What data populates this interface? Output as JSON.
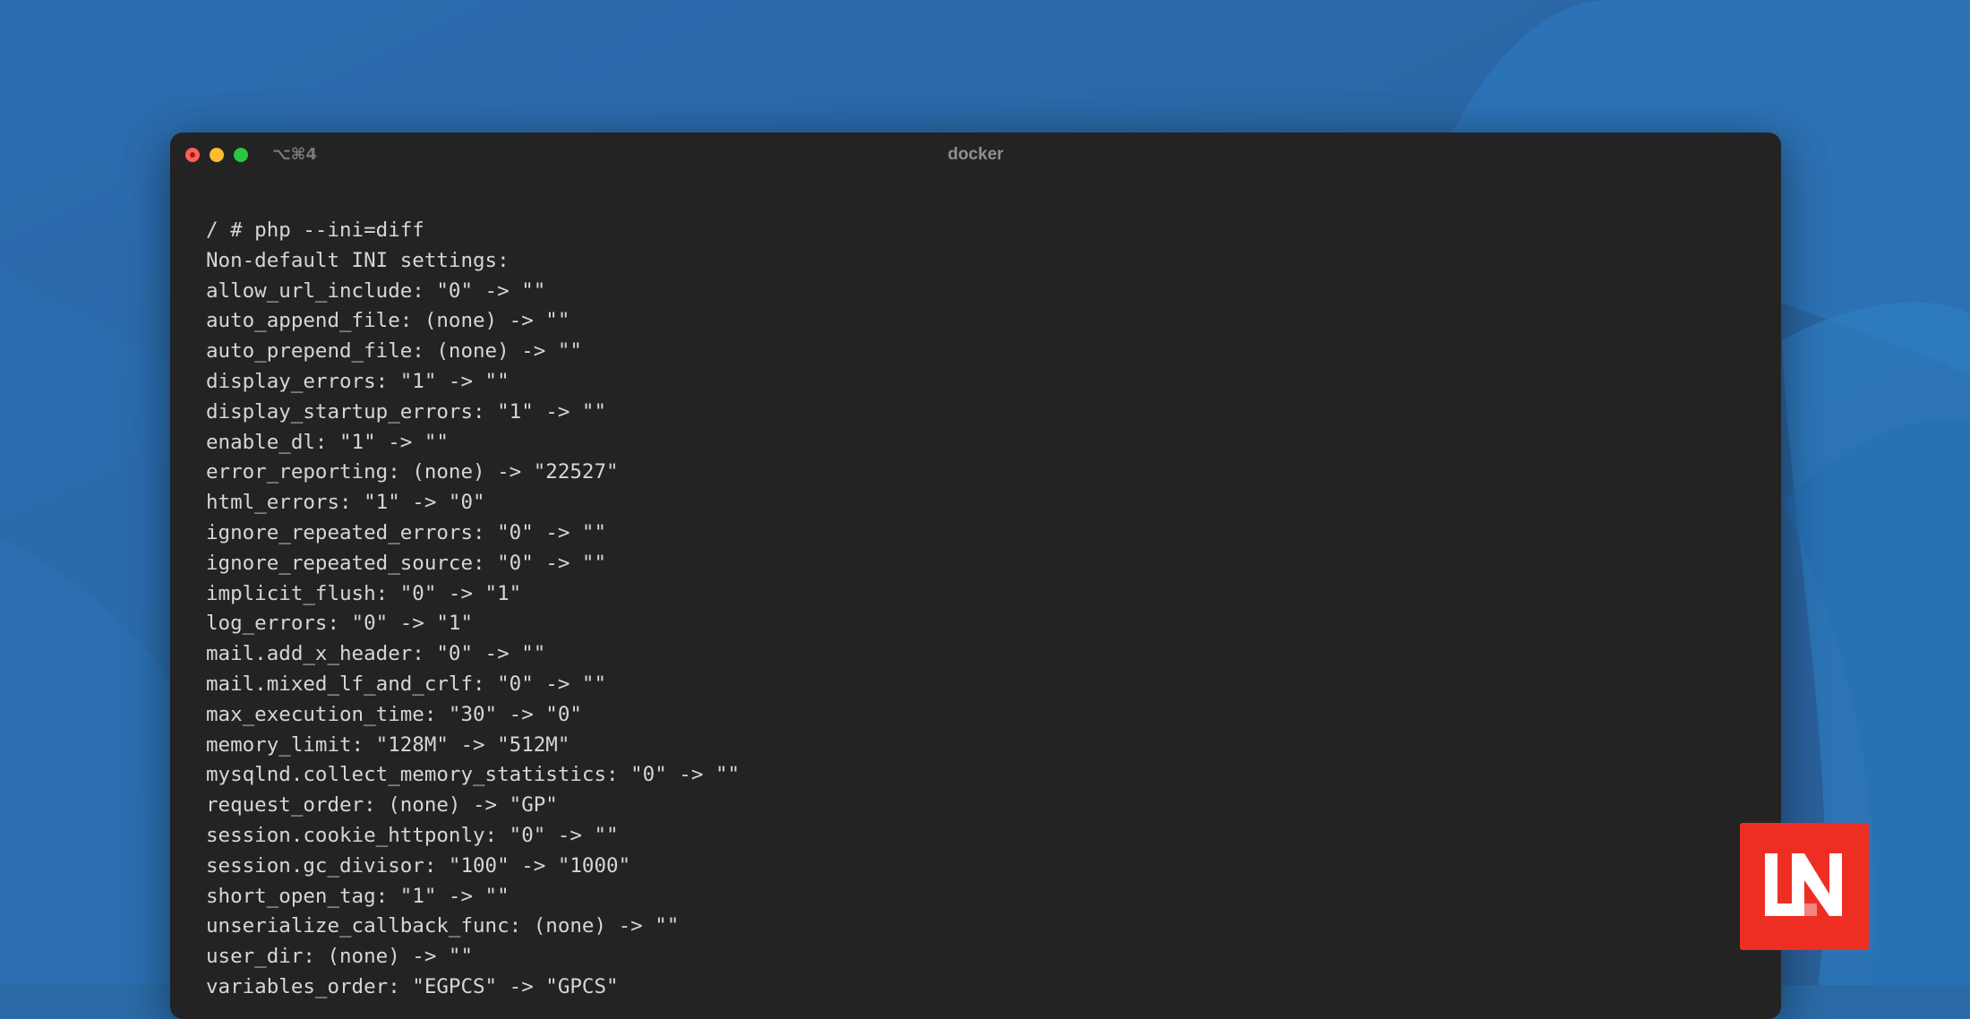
{
  "window": {
    "title": "docker",
    "shortcut": "⌥⌘4"
  },
  "terminal": {
    "lines": [
      "/ # php --ini=diff",
      "Non-default INI settings:",
      "allow_url_include: \"0\" -> \"\"",
      "auto_append_file: (none) -> \"\"",
      "auto_prepend_file: (none) -> \"\"",
      "display_errors: \"1\" -> \"\"",
      "display_startup_errors: \"1\" -> \"\"",
      "enable_dl: \"1\" -> \"\"",
      "error_reporting: (none) -> \"22527\"",
      "html_errors: \"1\" -> \"0\"",
      "ignore_repeated_errors: \"0\" -> \"\"",
      "ignore_repeated_source: \"0\" -> \"\"",
      "implicit_flush: \"0\" -> \"1\"",
      "log_errors: \"0\" -> \"1\"",
      "mail.add_x_header: \"0\" -> \"\"",
      "mail.mixed_lf_and_crlf: \"0\" -> \"\"",
      "max_execution_time: \"30\" -> \"0\"",
      "memory_limit: \"128M\" -> \"512M\"",
      "mysqlnd.collect_memory_statistics: \"0\" -> \"\"",
      "request_order: (none) -> \"GP\"",
      "session.cookie_httponly: \"0\" -> \"\"",
      "session.gc_divisor: \"100\" -> \"1000\"",
      "short_open_tag: \"1\" -> \"\"",
      "unserialize_callback_func: (none) -> \"\"",
      "user_dir: (none) -> \"\"",
      "variables_order: \"EGPCS\" -> \"GPCS\""
    ]
  },
  "colors": {
    "background": "#2a6aa6",
    "window": "#232323",
    "text": "#d6d6d6",
    "logo": "#ef2e23"
  },
  "icons": {
    "close": "close-icon",
    "minimize": "minimize-icon",
    "zoom": "zoom-icon",
    "logo": "laravel-news-logo-icon"
  }
}
